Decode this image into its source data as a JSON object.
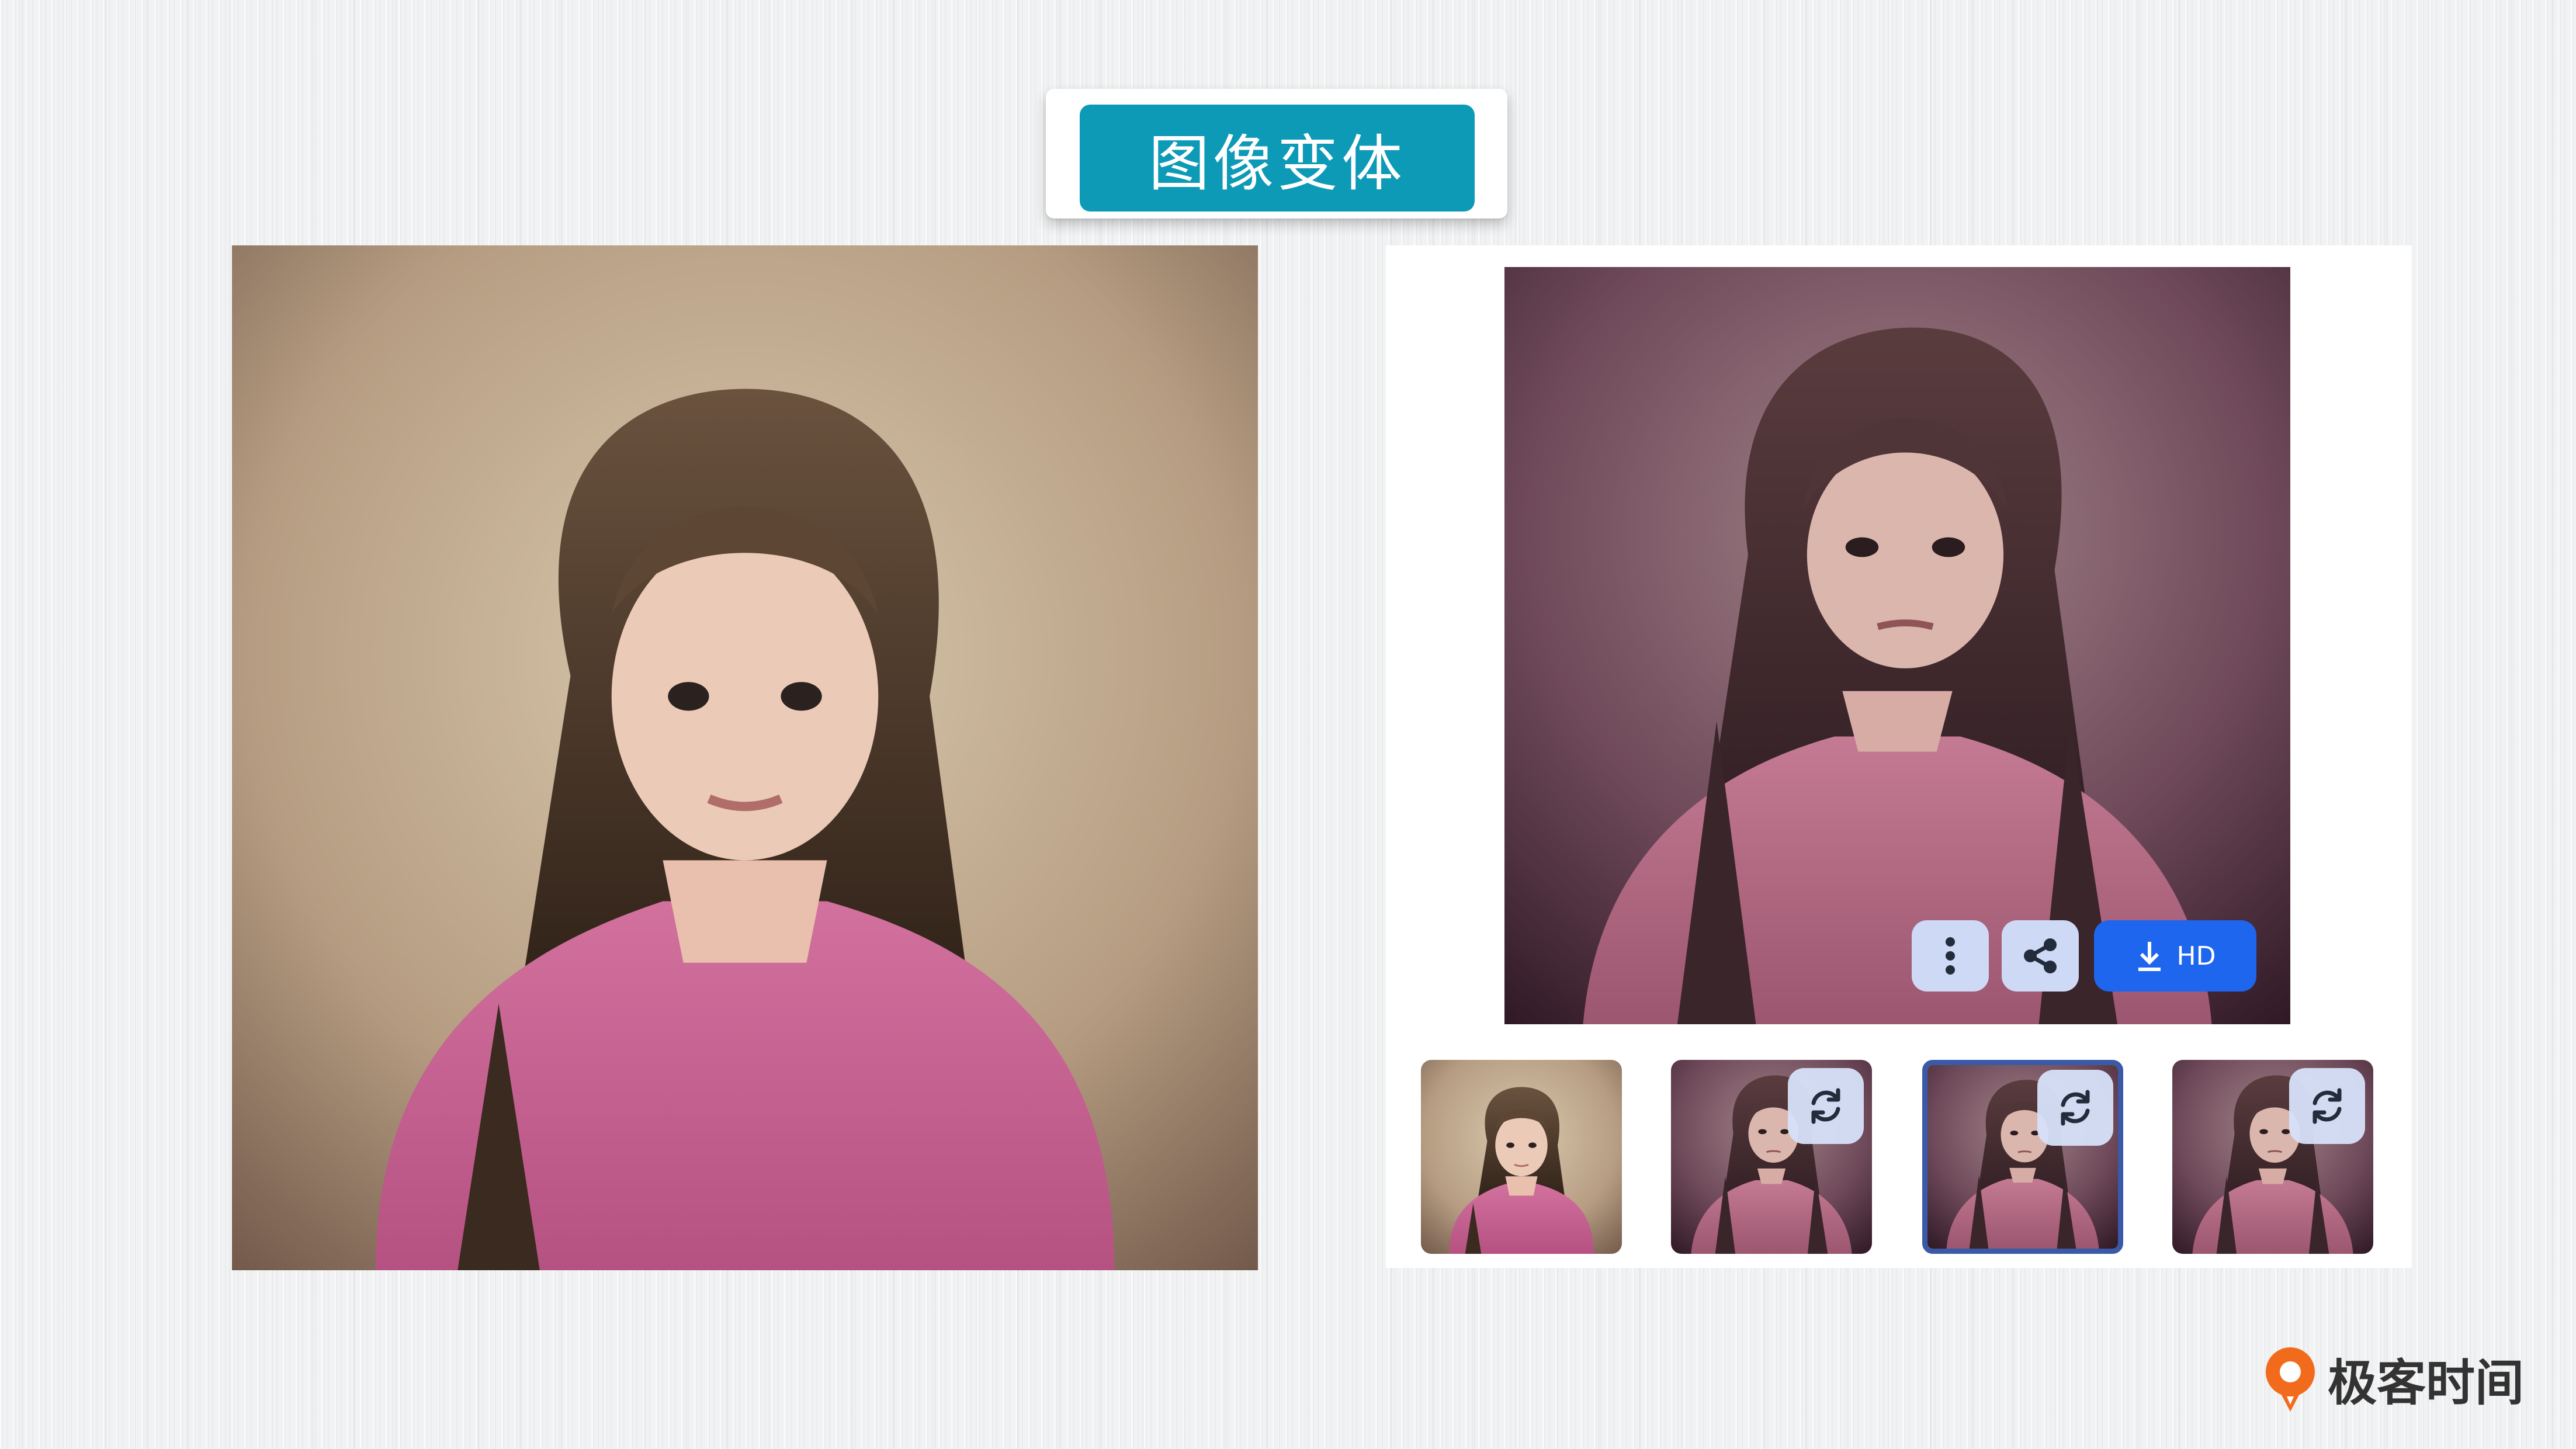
{
  "title": "图像变体",
  "source_image": {
    "icon": "portrait-photo-girl-pink-dress"
  },
  "result_panel": {
    "main_image": {
      "icon": "portrait-photo-variation"
    },
    "actions": {
      "more_icon": "vertical-dots-icon",
      "share_icon": "share-icon",
      "download_icon": "download-icon",
      "download_label": "HD"
    },
    "thumbnails": [
      {
        "selected": false,
        "has_regenerate": false
      },
      {
        "selected": false,
        "has_regenerate": true
      },
      {
        "selected": true,
        "has_regenerate": true
      },
      {
        "selected": false,
        "has_regenerate": true
      }
    ],
    "regenerate_icon": "refresh-icon"
  },
  "brand": {
    "name": "极客时间",
    "logo_icon": "geektime-logo-icon"
  },
  "colors": {
    "title_bg": "#0d9ab6",
    "hd_button_bg": "#1f66ee",
    "secondary_button_bg": "#cdd9f5",
    "selected_thumb_border": "#3a5aa8",
    "brand_orange": "#f26b1d"
  }
}
